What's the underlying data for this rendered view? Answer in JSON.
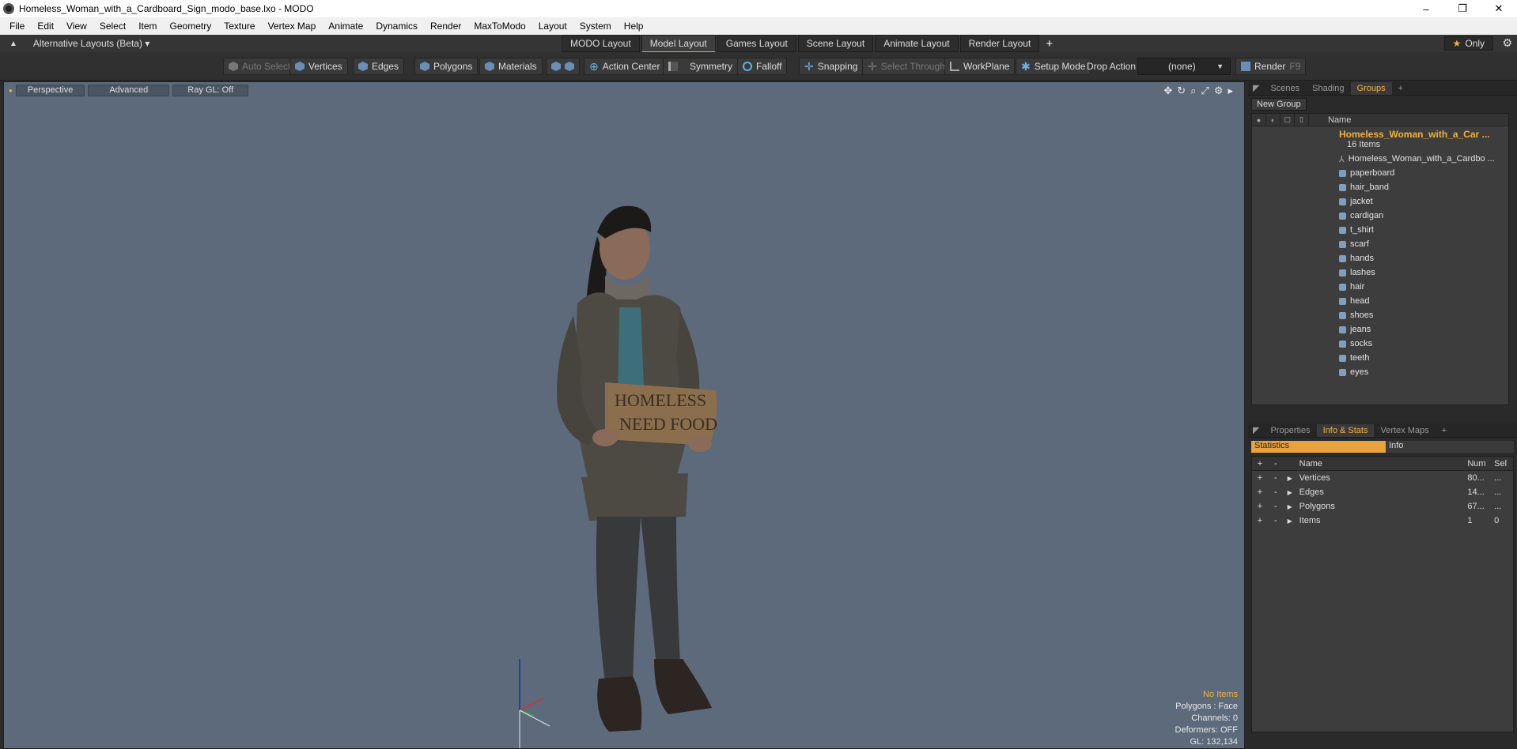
{
  "window": {
    "title": "Homeless_Woman_with_a_Cardboard_Sign_modo_base.lxo - MODO",
    "controls": [
      "–",
      "❐",
      "✕"
    ]
  },
  "menu": [
    "File",
    "Edit",
    "View",
    "Select",
    "Item",
    "Geometry",
    "Texture",
    "Vertex Map",
    "Animate",
    "Dynamics",
    "Render",
    "MaxToModo",
    "Layout",
    "System",
    "Help"
  ],
  "layoutbar": {
    "alt_layouts": "Alternative Layouts (Beta) ▾",
    "tabs": [
      "MODO Layout",
      "Model Layout",
      "Games Layout",
      "Scene Layout",
      "Animate Layout",
      "Render Layout"
    ],
    "active_tab": "Model Layout",
    "add": "+",
    "only": "Only"
  },
  "toolbar": {
    "auto_select": "Auto Select",
    "vertices": "Vertices",
    "edges": "Edges",
    "polygons": "Polygons",
    "materials": "Materials",
    "action_center": "Action Center",
    "symmetry": "Symmetry",
    "falloff": "Falloff",
    "snapping": "Snapping",
    "select_through": "Select Through",
    "workplane": "WorkPlane",
    "setup_mode": "Setup Mode",
    "drop_action": "Drop Action",
    "drop_value": "(none)",
    "render": "Render",
    "render_key": "F9"
  },
  "viewport": {
    "perspective": "Perspective",
    "advanced": "Advanced",
    "raygl": "Ray GL: Off",
    "sign_text": "HOMELESS NEED FOOD",
    "info": {
      "items": "No Items",
      "polygons": "Polygons : Face",
      "channels": "Channels: 0",
      "deformers": "Deformers: OFF",
      "gl": "GL: 132,134"
    }
  },
  "groups_panel": {
    "tabs": [
      "Scenes",
      "Shading",
      "Groups",
      "+"
    ],
    "active_tab": "Groups",
    "new_group": "New Group",
    "name_header": "Name",
    "root_name": "Homeless_Woman_with_a_Car ...",
    "root_count": "16 Items",
    "items": [
      "Homeless_Woman_with_a_Cardbo ...",
      "paperboard",
      "hair_band",
      "jacket",
      "cardigan",
      "t_shirt",
      "scarf",
      "hands",
      "lashes",
      "hair",
      "head",
      "shoes",
      "jeans",
      "socks",
      "teeth",
      "eyes"
    ]
  },
  "info_panel": {
    "tabs": [
      "Properties",
      "Info & Stats",
      "Vertex Maps",
      "+"
    ],
    "active_tab": "Info & Stats",
    "statistics": "Statistics",
    "info": "Info",
    "headers": {
      "plus": "+",
      "minus": "-",
      "name": "Name",
      "num": "Num",
      "sel": "Sel"
    },
    "rows": [
      {
        "name": "Vertices",
        "num": "80...",
        "sel": "..."
      },
      {
        "name": "Edges",
        "num": "14...",
        "sel": "..."
      },
      {
        "name": "Polygons",
        "num": "67...",
        "sel": "..."
      },
      {
        "name": "Items",
        "num": "1",
        "sel": "0"
      }
    ]
  }
}
